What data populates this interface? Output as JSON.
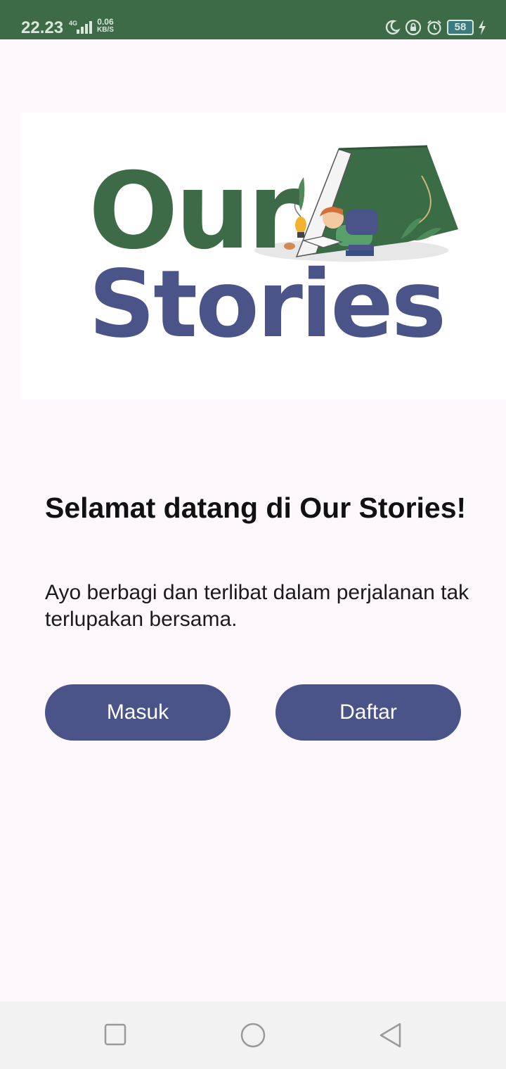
{
  "status_bar": {
    "time": "22.23",
    "network": "4G",
    "speed_value": "0.06",
    "speed_unit": "KB/S",
    "battery": "58",
    "icons": [
      "moon-icon",
      "rotation-lock-icon",
      "alarm-icon",
      "battery-icon",
      "charging-icon"
    ]
  },
  "logo": {
    "line1": "Our",
    "line2": "Stories",
    "colors": {
      "our": "#3d6a47",
      "stories": "#4a5488"
    }
  },
  "welcome": {
    "title": "Selamat datang di Our Stories!",
    "subtitle": "Ayo berbagi dan terlibat dalam perjalanan tak terlupakan bersama."
  },
  "buttons": {
    "login": "Masuk",
    "register": "Daftar"
  },
  "nav": {
    "icons": [
      "recent-apps-icon",
      "home-icon",
      "back-icon"
    ]
  },
  "colors": {
    "status_bar": "#3d6a47",
    "accent": "#4a5488",
    "background": "#fdf8fc"
  }
}
